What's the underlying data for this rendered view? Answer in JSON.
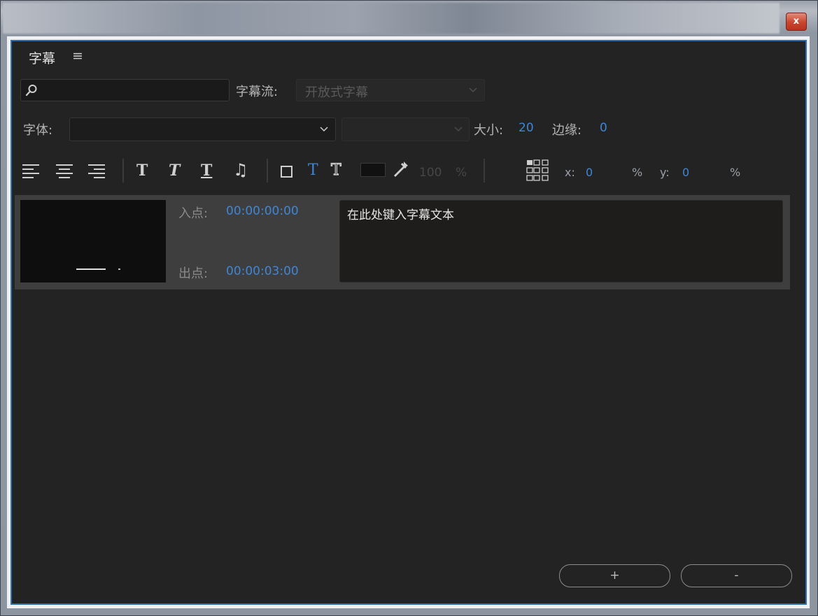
{
  "window": {
    "close_label": "x"
  },
  "panel": {
    "title": "字幕",
    "menu_icon": "≡"
  },
  "search": {
    "placeholder": "",
    "value": ""
  },
  "stream": {
    "label": "字幕流:",
    "value": "开放式字幕"
  },
  "font": {
    "label": "字体:",
    "family": "",
    "style": ""
  },
  "size": {
    "label": "大小:",
    "value": "20"
  },
  "edge": {
    "label": "边缘:",
    "value": "0"
  },
  "toolbar": {
    "align_icons": [
      "align-left-icon",
      "align-center-icon",
      "align-right-icon"
    ],
    "bold_glyph": "T",
    "italic_glyph": "T",
    "underline_glyph": "T",
    "music_glyph": "♫",
    "text_color_glyph": "T",
    "outline_glyph": "T",
    "opacity_value": "100",
    "opacity_unit": "%",
    "x_label": "x:",
    "x_value": "0",
    "x_unit": "%",
    "y_label": "y:",
    "y_value": "0",
    "y_unit": "%",
    "colors": {
      "active_blue": "#3f86d6",
      "swatch": "#111111"
    }
  },
  "captions": [
    {
      "in_label": "入点:",
      "in_time": "00:00:00:00",
      "out_label": "出点:",
      "out_time": "00:00:03:00",
      "text": "在此处键入字幕文本"
    }
  ],
  "footer": {
    "add_label": "+",
    "remove_label": "-"
  }
}
